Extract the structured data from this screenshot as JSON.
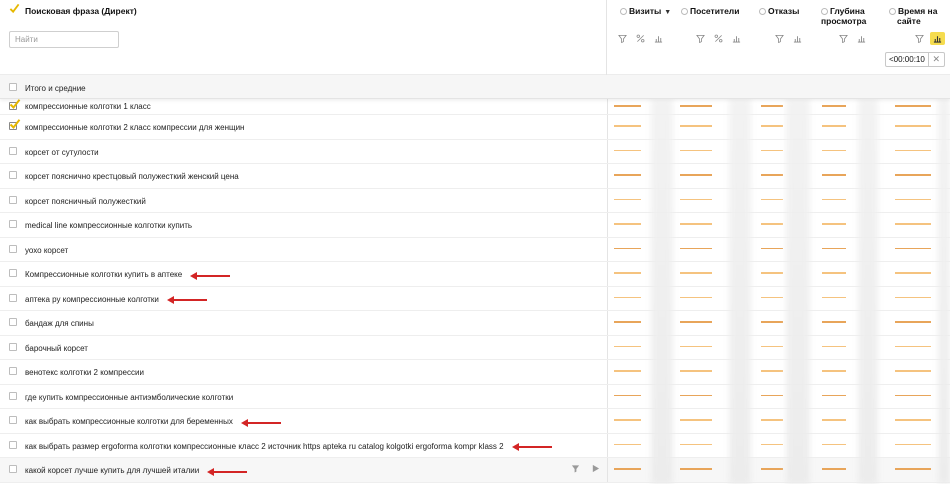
{
  "header": {
    "phrase_column_title": "Поисковая фраза (Директ)",
    "search_placeholder": "Найти",
    "columns": [
      {
        "title": "Визиты",
        "sorted": "▼"
      },
      {
        "title": "Посетители"
      },
      {
        "title": "Отказы"
      },
      {
        "title_line1": "Глубина",
        "title_line2": "просмотра"
      },
      {
        "title_line1": "Время на",
        "title_line2": "сайте"
      }
    ],
    "filter_chip": "<00:00:10",
    "icons": {
      "filter": "funnel-icon",
      "percent": "percent-icon",
      "chart": "bar-chart-icon",
      "close": "close-icon",
      "play": "play-icon"
    }
  },
  "totals": {
    "label": "Итого и средние"
  },
  "rows": [
    {
      "label": "компрессионные колготки 1 класс",
      "checked": true
    },
    {
      "label": "компрессионные колготки 2 класс компрессии для женщин",
      "checked": true
    },
    {
      "label": "корсет от сутулости",
      "checked": false
    },
    {
      "label": "корсет пояснично крестцовый полужесткий женский цена",
      "checked": false
    },
    {
      "label": "корсет поясничный полужесткий",
      "checked": false
    },
    {
      "label": "medical line компрессионные колготки купить",
      "checked": false
    },
    {
      "label": "уохо корсет",
      "checked": false
    },
    {
      "label": "Компрессионные колготки купить в аптеке",
      "checked": false,
      "arrow": true
    },
    {
      "label": "аптека ру компрессионные колготки",
      "checked": false,
      "arrow": true
    },
    {
      "label": "бандаж для спины",
      "checked": false
    },
    {
      "label": "барочный корсет",
      "checked": false
    },
    {
      "label": "венотекс колготки 2 компрессии",
      "checked": false
    },
    {
      "label": "где купить компрессионные антиэмболические колготки",
      "checked": false
    },
    {
      "label": "как выбрать компрессионные колготки для беременных",
      "checked": false,
      "arrow": true
    },
    {
      "label": "как выбрать размер ergoforma колготки компрессионные класс 2 источник https apteka ru catalog kolgotki ergoforma kompr klass 2",
      "checked": false,
      "arrow": true
    },
    {
      "label": "какой корсет лучше купить для лучшей италии",
      "checked": false,
      "arrow": true
    }
  ],
  "colors": {
    "accent": "#f5dc4f",
    "bar": "#f5c37f",
    "arrow": "#d32525",
    "check": "#e6b800"
  }
}
